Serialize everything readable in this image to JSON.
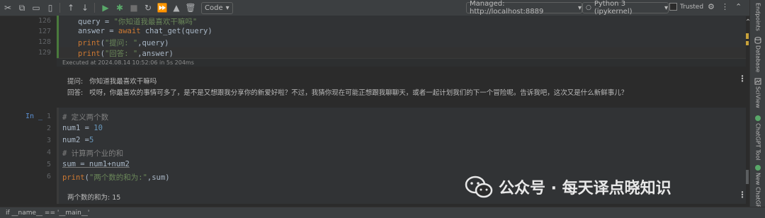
{
  "toolbar": {
    "cell_type": "Code",
    "kernel_url": "Managed: http://localhost:8889",
    "kernel": "Python 3 (ipykernel)",
    "trusted_label": "Trusted"
  },
  "inspections": {
    "warnings": "7",
    "weak_warnings": "14",
    "ok": "9"
  },
  "sidebar": {
    "tabs": [
      "Endpoints",
      "Database",
      "SciView",
      "ChatGPT Tool",
      "New ChatGPT"
    ]
  },
  "cell1": {
    "line_numbers": [
      "126",
      "127",
      "128",
      "129"
    ],
    "lines": [
      [
        {
          "t": "query",
          "c": "d"
        },
        {
          "t": " = ",
          "c": "d"
        },
        {
          "t": "\"你知道我最喜欢干嘛吗\"",
          "c": "s"
        }
      ],
      [
        {
          "t": "answer",
          "c": "d"
        },
        {
          "t": " = ",
          "c": "d"
        },
        {
          "t": "await ",
          "c": "k"
        },
        {
          "t": "chat_get(query)",
          "c": "d"
        }
      ],
      [
        {
          "t": "print",
          "c": "k"
        },
        {
          "t": "(",
          "c": "d"
        },
        {
          "t": "\"提问: \"",
          "c": "s"
        },
        {
          "t": ",query)",
          "c": "d"
        }
      ],
      [
        {
          "t": "print",
          "c": "k"
        },
        {
          "t": "(",
          "c": "d"
        },
        {
          "t": "\"回答: \"",
          "c": "s"
        },
        {
          "t": ",answer)",
          "c": "d"
        }
      ]
    ],
    "executed": "Executed at 2024.08.14 10:52:06 in 5s 204ms",
    "output_lines": [
      "提问:   你知道我最喜欢干嘛吗",
      "回答:   哎呀，你最喜欢的事情可多了，是不是又想跟我分享你的新爱好啦？不过，我猜你现在可能正想跟我聊聊天，或者一起计划我们的下一个冒险呢。告诉我吧，这次又是什么新鲜事儿？"
    ]
  },
  "cell2": {
    "prompt": "In _",
    "line_numbers": [
      "1",
      "2",
      "3",
      "4",
      "5",
      "6"
    ],
    "lines": [
      [
        {
          "t": "# 定义两个数",
          "c": "c"
        }
      ],
      [
        {
          "t": "num1 = ",
          "c": "d"
        },
        {
          "t": "10",
          "c": "n"
        }
      ],
      [
        {
          "t": "num2 =",
          "c": "d"
        },
        {
          "t": "5",
          "c": "n"
        }
      ],
      [
        {
          "t": "# 计算两个业的和",
          "c": "c"
        }
      ],
      [
        {
          "t": "sum",
          "c": "d"
        },
        {
          "t": " = num1+num2",
          "c": "d"
        }
      ],
      [
        {
          "t": "print",
          "c": "k"
        },
        {
          "t": "(",
          "c": "d"
        },
        {
          "t": "\"两个数的和为:\"",
          "c": "s"
        },
        {
          "t": ",sum)",
          "c": "d"
        }
      ]
    ],
    "output": "两个数的和为: 15"
  },
  "watermark": "公众号 · 每天译点晓知识",
  "statusbar": {
    "text": "if __name__ == '__main__'"
  }
}
